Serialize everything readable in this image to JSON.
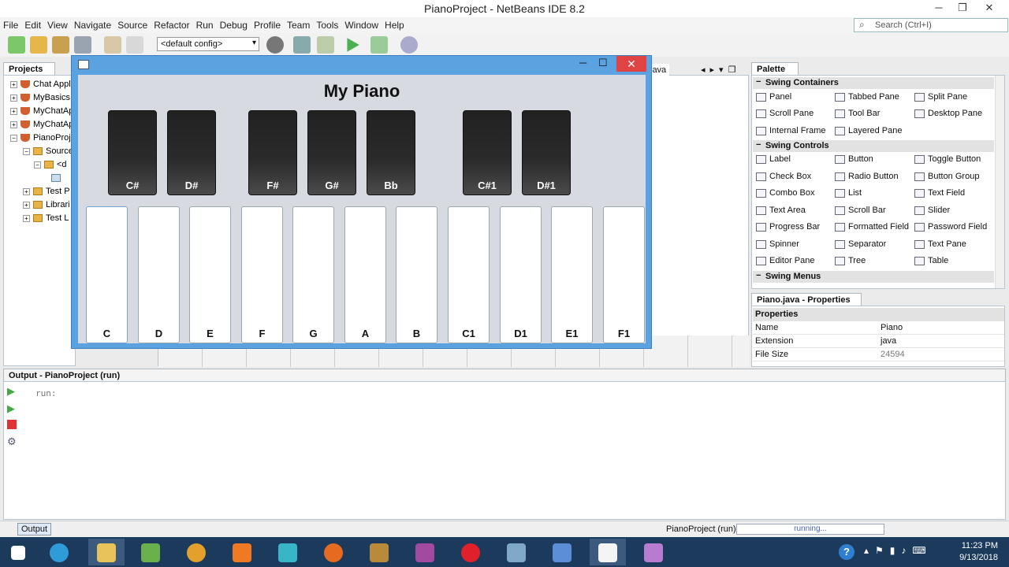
{
  "window": {
    "title": "PianoProject - NetBeans IDE 8.2"
  },
  "menu": [
    "File",
    "Edit",
    "View",
    "Navigate",
    "Source",
    "Refactor",
    "Run",
    "Debug",
    "Profile",
    "Team",
    "Tools",
    "Window",
    "Help"
  ],
  "search": {
    "placeholder": "Search (Ctrl+I)"
  },
  "toolbar": {
    "config": "<default config>"
  },
  "projects": {
    "tab": "Projects",
    "items": [
      "Chat Appli",
      "MyBasics",
      "MyChatAp",
      "MyChatAp",
      "PianoProje",
      "Source",
      "<d",
      "Test P",
      "Librari",
      "Test L"
    ]
  },
  "editor": {
    "tab": "java"
  },
  "palette": {
    "tab": "Palette",
    "sections": [
      {
        "name": "Swing Containers",
        "items": [
          "Panel",
          "Tabbed Pane",
          "Split Pane",
          "Scroll Pane",
          "Tool Bar",
          "Desktop Pane",
          "Internal Frame",
          "Layered Pane"
        ]
      },
      {
        "name": "Swing Controls",
        "items": [
          "Label",
          "Button",
          "Toggle Button",
          "Check Box",
          "Radio Button",
          "Button Group",
          "Combo Box",
          "List",
          "Text Field",
          "Text Area",
          "Scroll Bar",
          "Slider",
          "Progress Bar",
          "Formatted Field",
          "Password Field",
          "Spinner",
          "Separator",
          "Text Pane",
          "Editor Pane",
          "Tree",
          "Table"
        ]
      },
      {
        "name": "Swing Menus",
        "items": []
      }
    ]
  },
  "properties": {
    "tab": "Piano.java - Properties",
    "section": "Properties",
    "rows": [
      {
        "k": "Name",
        "v": "Piano"
      },
      {
        "k": "Extension",
        "v": "java"
      },
      {
        "k": "File Size",
        "v": "24594"
      }
    ]
  },
  "output": {
    "tab": "Output - PianoProject (run)",
    "text": "run:",
    "bottom_tab": "Output"
  },
  "status": {
    "project": "PianoProject (run)",
    "progress": "running..."
  },
  "clock": {
    "time": "11:23 PM",
    "date": "9/13/2018"
  },
  "piano": {
    "heading": "My Piano",
    "black_keys": [
      "C#",
      "D#",
      "F#",
      "G#",
      "Bb",
      "C#1",
      "D#1"
    ],
    "white_keys": [
      "C",
      "D",
      "E",
      "F",
      "G",
      "A",
      "B",
      "C1",
      "D1",
      "E1",
      "F1"
    ]
  }
}
